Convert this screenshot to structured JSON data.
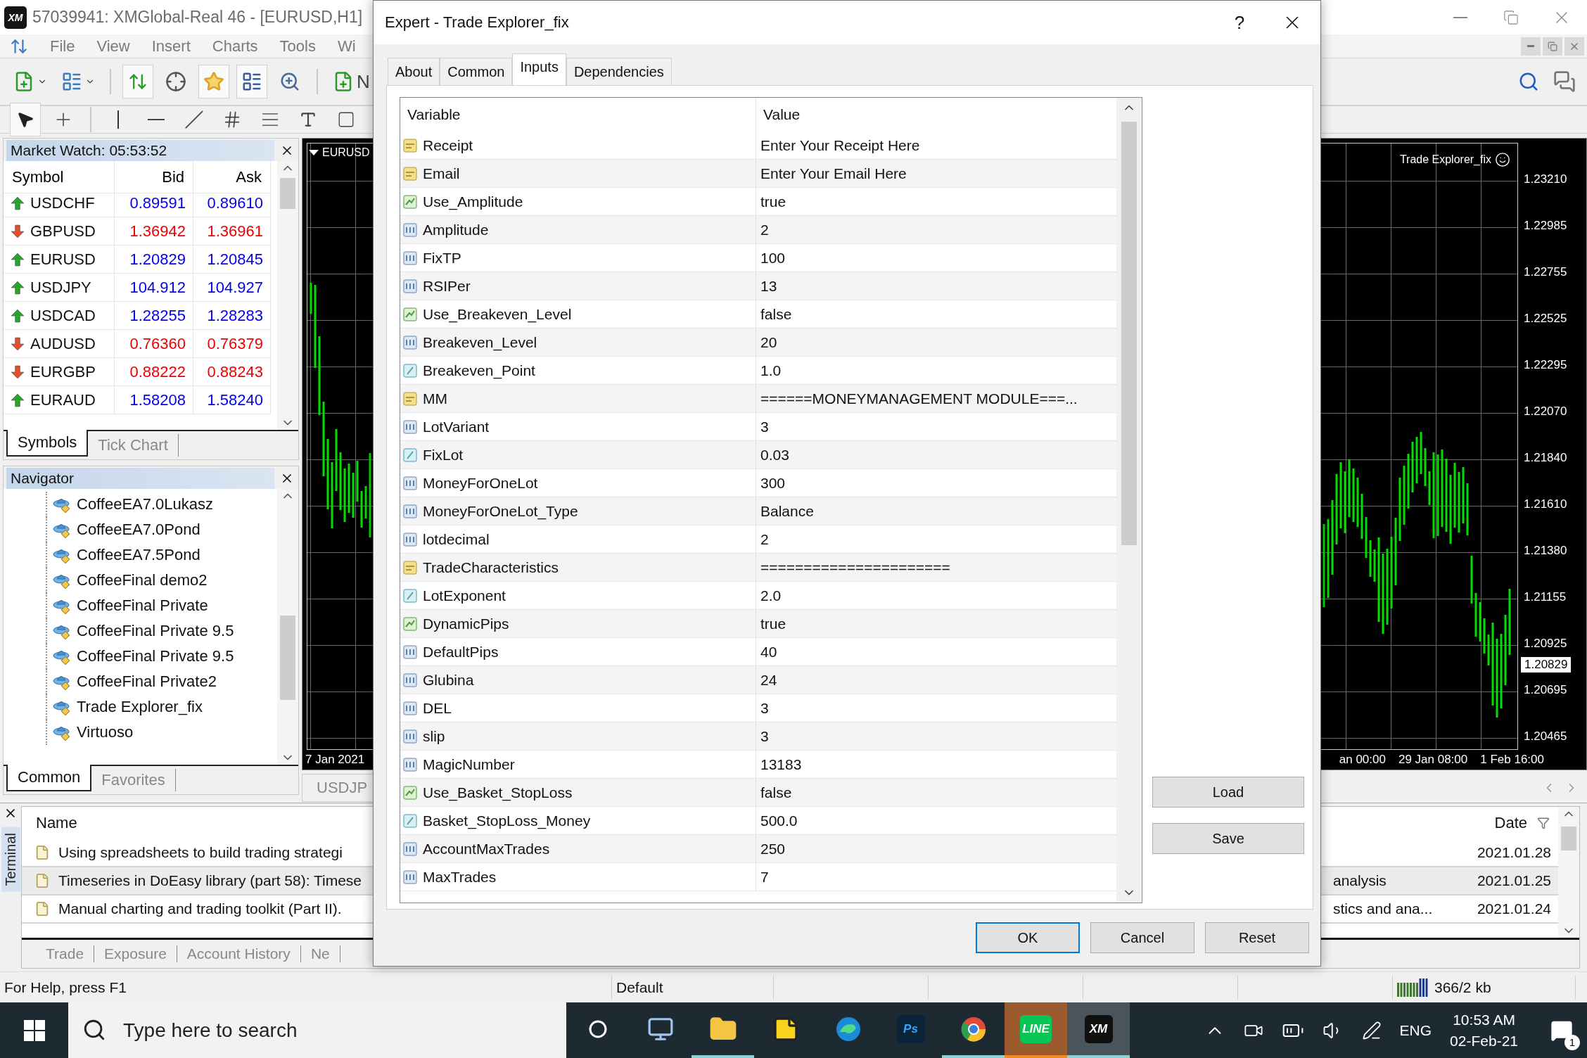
{
  "window": {
    "logo": "XM",
    "title": "57039941: XMGlobal-Real 46 - [EURUSD,H1]"
  },
  "menu": [
    "File",
    "View",
    "Insert",
    "Charts",
    "Tools",
    "Wi"
  ],
  "toolbar": {
    "new_order_label": "N"
  },
  "market_watch": {
    "title": "Market Watch: 05:53:52",
    "columns": [
      "Symbol",
      "Bid",
      "Ask"
    ],
    "rows": [
      {
        "symbol": "USDCHF",
        "kind": "up",
        "bid": "0.89591",
        "ask": "0.89610"
      },
      {
        "symbol": "GBPUSD",
        "kind": "down",
        "bid": "1.36942",
        "ask": "1.36961"
      },
      {
        "symbol": "EURUSD",
        "kind": "up",
        "bid": "1.20829",
        "ask": "1.20845"
      },
      {
        "symbol": "USDJPY",
        "kind": "up",
        "bid": "104.912",
        "ask": "104.927"
      },
      {
        "symbol": "USDCAD",
        "kind": "up",
        "bid": "1.28255",
        "ask": "1.28283"
      },
      {
        "symbol": "AUDUSD",
        "kind": "down",
        "bid": "0.76360",
        "ask": "0.76379"
      },
      {
        "symbol": "EURGBP",
        "kind": "down",
        "bid": "0.88222",
        "ask": "0.88243"
      },
      {
        "symbol": "EURAUD",
        "kind": "up",
        "bid": "1.58208",
        "ask": "1.58240"
      }
    ],
    "tabs": [
      {
        "label": "Symbols",
        "selected": true
      },
      {
        "label": "Tick Chart",
        "selected": false
      }
    ]
  },
  "navigator": {
    "title": "Navigator",
    "items": [
      "CoffeeEA7.0Lukasz",
      "CoffeeEA7.0Pond",
      "CoffeeEA7.5Pond",
      "CoffeeFinal demo2",
      "CoffeeFinal Private",
      "CoffeeFinal Private 9.5",
      "CoffeeFinal Private 9.5",
      "CoffeeFinal Private2",
      "Trade Explorer_fix",
      "Virtuoso"
    ],
    "tabs": [
      {
        "label": "Common",
        "selected": true
      },
      {
        "label": "Favorites",
        "selected": false
      }
    ]
  },
  "chart": {
    "symbol_label": "EURUSD",
    "expert_label": "Trade Explorer_fix",
    "price_labels": [
      "1.23210",
      "1.22985",
      "1.22755",
      "1.22525",
      "1.22295",
      "1.22070",
      "1.21840",
      "1.21610",
      "1.21380",
      "1.21155",
      "1.20925",
      "1.20695",
      "1.20465"
    ],
    "current_price": "1.20829",
    "time_label_left": "7 Jan 2021",
    "time_labels_right": [
      "an 00:00",
      "29 Jan 08:00",
      "1 Feb 16:00"
    ],
    "tabs": [
      "USDJP"
    ]
  },
  "terminal": {
    "title": "Terminal",
    "columns": [
      "Name",
      "Date"
    ],
    "rows": [
      {
        "name": "Using spreadsheets to build trading strategi",
        "date": "2021.01.28",
        "selected": false
      },
      {
        "name": "Timeseries in DoEasy library (part 58): Timese",
        "name_end": "analysis",
        "date": "2021.01.25",
        "selected": true
      },
      {
        "name": "Manual charting and trading toolkit (Part II).",
        "name_end": "stics and ana...",
        "date": "2021.01.24",
        "selected": false
      }
    ],
    "tabs": [
      "Trade",
      "Exposure",
      "Account History",
      "Ne"
    ]
  },
  "status_bar": {
    "help": "For Help, press F1",
    "profile": "Default",
    "traffic": "366/2 kb"
  },
  "taskbar": {
    "search_placeholder": "Type here to search",
    "apps": [
      {
        "kind": "circle",
        "open": false,
        "active": false,
        "flashing": false
      },
      {
        "kind": "remote",
        "open": false,
        "active": false,
        "flashing": false
      },
      {
        "kind": "folder",
        "open": true,
        "active": false,
        "flashing": false
      },
      {
        "kind": "note",
        "open": false,
        "active": false,
        "flashing": false
      },
      {
        "kind": "browser",
        "open": false,
        "active": false,
        "flashing": false
      },
      {
        "kind": "ps",
        "label": "Ps",
        "open": false,
        "active": false,
        "flashing": false
      },
      {
        "kind": "globe",
        "open": true,
        "active": false,
        "flashing": false
      },
      {
        "kind": "line",
        "label": "LINE",
        "open": true,
        "active": false,
        "flashing": true
      },
      {
        "kind": "xm",
        "label": "XM",
        "open": true,
        "active": true,
        "flashing": false
      }
    ],
    "language": "ENG",
    "time": "10:53 AM",
    "date": "02-Feb-21",
    "notifications": "1"
  },
  "dialog": {
    "title": "Expert - Trade Explorer_fix",
    "help": "?",
    "tabs": [
      {
        "label": "About",
        "selected": false
      },
      {
        "label": "Common",
        "selected": false
      },
      {
        "label": "Inputs",
        "selected": true
      },
      {
        "label": "Dependencies",
        "selected": false
      }
    ],
    "columns": [
      "Variable",
      "Value"
    ],
    "rows": [
      {
        "kind": "string",
        "variable": "Receipt",
        "value": "Enter Your Receipt Here"
      },
      {
        "kind": "string",
        "variable": "Email",
        "value": "Enter Your Email Here"
      },
      {
        "kind": "bool",
        "variable": "Use_Amplitude",
        "value": "true"
      },
      {
        "kind": "int",
        "variable": "Amplitude",
        "value": "2"
      },
      {
        "kind": "int",
        "variable": "FixTP",
        "value": "100"
      },
      {
        "kind": "int",
        "variable": "RSIPer",
        "value": "13"
      },
      {
        "kind": "bool",
        "variable": "Use_Breakeven_Level",
        "value": "false"
      },
      {
        "kind": "int",
        "variable": "Breakeven_Level",
        "value": "20"
      },
      {
        "kind": "double",
        "variable": "Breakeven_Point",
        "value": "1.0"
      },
      {
        "kind": "string",
        "variable": "MM",
        "value": "======MONEYMANAGEMENT MODULE===..."
      },
      {
        "kind": "int",
        "variable": "LotVariant",
        "value": "3"
      },
      {
        "kind": "double",
        "variable": "FixLot",
        "value": "0.03"
      },
      {
        "kind": "int",
        "variable": "MoneyForOneLot",
        "value": "300"
      },
      {
        "kind": "int",
        "variable": "MoneyForOneLot_Type",
        "value": "Balance"
      },
      {
        "kind": "int",
        "variable": "lotdecimal",
        "value": "2"
      },
      {
        "kind": "string",
        "variable": "TradeCharacteristics",
        "value": "======================"
      },
      {
        "kind": "double",
        "variable": "LotExponent",
        "value": "2.0"
      },
      {
        "kind": "bool",
        "variable": "DynamicPips",
        "value": "true"
      },
      {
        "kind": "int",
        "variable": "DefaultPips",
        "value": "40"
      },
      {
        "kind": "int",
        "variable": "Glubina",
        "value": "24"
      },
      {
        "kind": "int",
        "variable": "DEL",
        "value": "3"
      },
      {
        "kind": "int",
        "variable": "slip",
        "value": "3"
      },
      {
        "kind": "int",
        "variable": "MagicNumber",
        "value": "13183"
      },
      {
        "kind": "bool",
        "variable": "Use_Basket_StopLoss",
        "value": "false"
      },
      {
        "kind": "double",
        "variable": "Basket_StopLoss_Money",
        "value": "500.0"
      },
      {
        "kind": "int",
        "variable": "AccountMaxTrades",
        "value": "250"
      },
      {
        "kind": "int",
        "variable": "MaxTrades",
        "value": "7"
      }
    ],
    "side_buttons": [
      "Load",
      "Save"
    ],
    "buttons": [
      {
        "label": "OK",
        "default": true
      },
      {
        "label": "Cancel",
        "default": false
      },
      {
        "label": "Reset",
        "default": false
      }
    ]
  }
}
